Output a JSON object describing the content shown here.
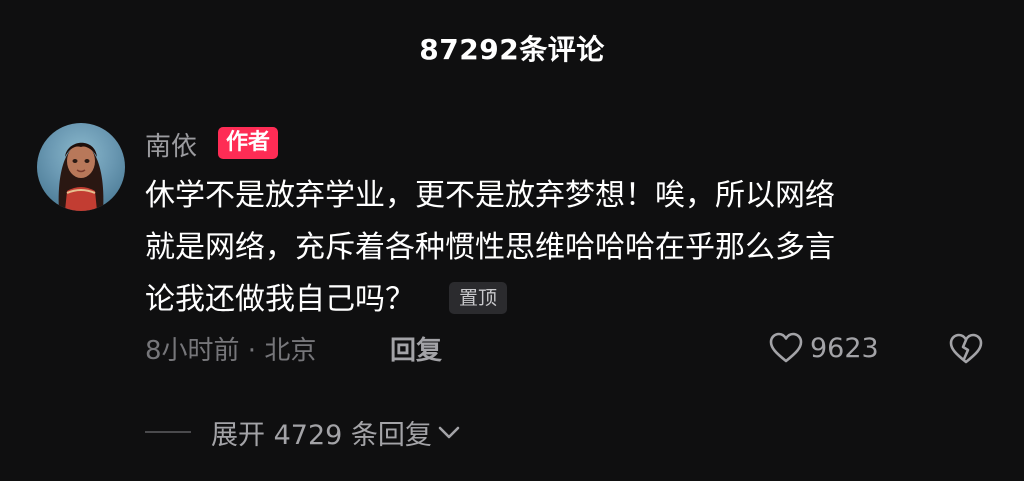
{
  "header": {
    "title": "87292条评论"
  },
  "comment": {
    "author_name": "南依",
    "author_badge": "作者",
    "avatar_icon": "avatar-image",
    "text_lines": [
      "休学不是放弃学业，更不是放弃梦想！唉，所以网络",
      "就是网络，充斥着各种惯性思维哈哈哈在乎那么多言",
      "论我还做我自己吗？"
    ],
    "pin_label": "置顶",
    "meta": "8小时前 · 北京",
    "reply_label": "回复",
    "like_icon": "heart-outline-icon",
    "like_count": "9623",
    "dislike_icon": "broken-heart-icon",
    "expand_label": "展开 4729 条回复",
    "expand_icon": "chevron-down-icon"
  },
  "colors": {
    "background": "#0f0f10",
    "badge": "#fe2c55",
    "muted": "#9b9b9f"
  }
}
